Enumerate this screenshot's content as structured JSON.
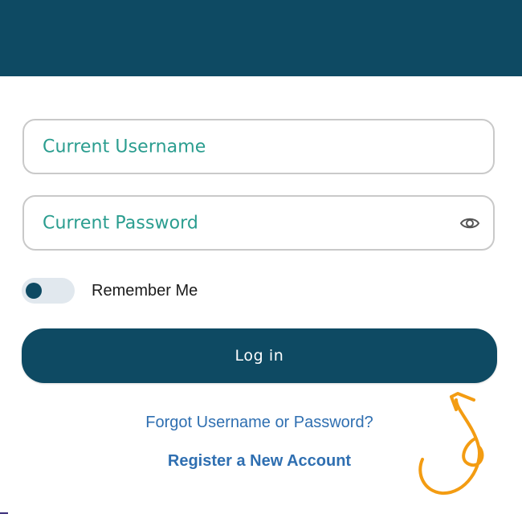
{
  "form": {
    "username_placeholder": "Current Username",
    "password_placeholder": "Current Password",
    "remember_label": "Remember Me",
    "remember_on": false,
    "login_label": "Log in",
    "forgot_link": "Forgot Username or Password?",
    "register_link": "Register a New Account"
  },
  "icons": {
    "password_visibility": "eye-icon",
    "annotation": "curved-arrow-icon"
  },
  "colors": {
    "brand": "#0e4a63",
    "placeholder": "#2a9d8f",
    "link": "#2f6fb1",
    "annotation": "#f39c12"
  }
}
